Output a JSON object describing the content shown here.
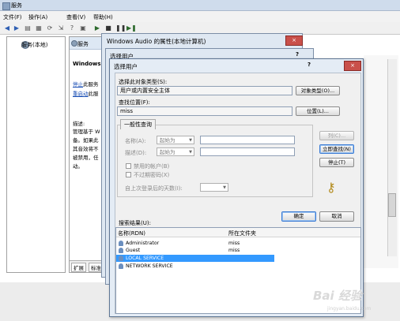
{
  "services_window": {
    "title": "服务",
    "menu": [
      "文件(F)",
      "操作(A)",
      "查看(V)",
      "帮助(H)"
    ],
    "left_tree_item": "服务(本地)",
    "panel_header": "服务",
    "panel_service_name": "Windows",
    "link_stop": "停止",
    "link_stop_suffix": "此服务",
    "link_restart": "重启动",
    "link_restart_suffix": "此服",
    "desc_label": "描述:",
    "desc_lines": [
      "管理基于 W",
      "备。如果此",
      "其音效将不",
      "被禁用，任",
      "动。"
    ],
    "tabs": [
      "扩展",
      "标准"
    ]
  },
  "audio_dialog": {
    "title": "Windows Audio 的属性(本地计算机)",
    "close": "×"
  },
  "mid_dialog": {
    "title": "选择用户",
    "help": "?"
  },
  "select_user_dialog": {
    "title": "选择用户",
    "help": "?",
    "close": "×",
    "object_type_label": "选择此对象类型(S):",
    "object_type_value": "用户或内置安全主体",
    "object_type_button": "对象类型(O)...",
    "location_label": "查找位置(F):",
    "location_value": "miss",
    "location_button": "位置(L)...",
    "tab_label": "一般性查询",
    "name_label": "名称(A):",
    "name_combo": "起始为",
    "desc_label": "描述(D):",
    "desc_combo": "起始为",
    "disabled_accounts": "禁用的帐户(B)",
    "no_expire_pwd": "不过期密码(X)",
    "days_since_logon": "自上次登录后的天数(I):",
    "btn_columns": "列(C)...",
    "btn_find_now": "立即查找(N)",
    "btn_stop": "停止(T)",
    "btn_ok": "确定",
    "btn_cancel": "取消",
    "results_label": "搜索结果(U):",
    "col_name": "名称(RDN)",
    "col_folder": "所在文件夹",
    "results": [
      {
        "name": "Administrator",
        "folder": "miss"
      },
      {
        "name": "Guest",
        "folder": "miss"
      },
      {
        "name": "LOCAL SERVICE",
        "folder": ""
      },
      {
        "name": "NETWORK SERVICE",
        "folder": ""
      }
    ]
  },
  "watermark": {
    "text": "Bai 经验",
    "sub": "jingyan.baidu.com"
  },
  "colors": {
    "selection": "#3399ff",
    "titlebar": "#cfdcec",
    "dialog": "#e4ecf5"
  }
}
